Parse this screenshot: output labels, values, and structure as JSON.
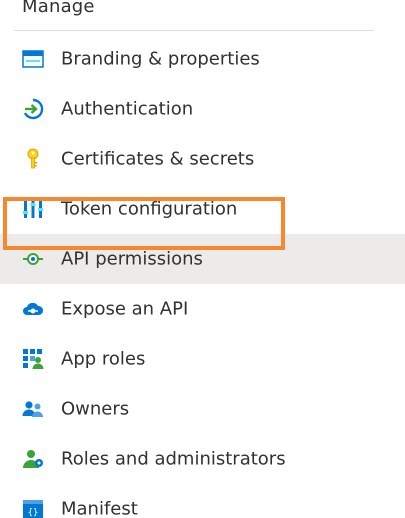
{
  "section": {
    "title": "Manage"
  },
  "nav_items": [
    {
      "label": "Branding & properties",
      "icon": "branding-icon",
      "selected": false
    },
    {
      "label": "Authentication",
      "icon": "authentication-icon",
      "selected": false
    },
    {
      "label": "Certificates & secrets",
      "icon": "key-icon",
      "selected": false
    },
    {
      "label": "Token configuration",
      "icon": "token-configuration-icon",
      "selected": false
    },
    {
      "label": "API permissions",
      "icon": "api-permissions-icon",
      "selected": true
    },
    {
      "label": "Expose an API",
      "icon": "cloud-icon",
      "selected": false
    },
    {
      "label": "App roles",
      "icon": "app-roles-icon",
      "selected": false
    },
    {
      "label": "Owners",
      "icon": "owners-icon",
      "selected": false
    },
    {
      "label": "Roles and administrators",
      "icon": "roles-admins-icon",
      "selected": false
    },
    {
      "label": "Manifest",
      "icon": "manifest-icon",
      "selected": false
    }
  ],
  "colors": {
    "highlight_outline": "#f7882f",
    "selected_background": "#edebe9",
    "icon_blue": "#0078d4",
    "icon_green": "#3ba337",
    "icon_yellow": "#fcd116"
  }
}
